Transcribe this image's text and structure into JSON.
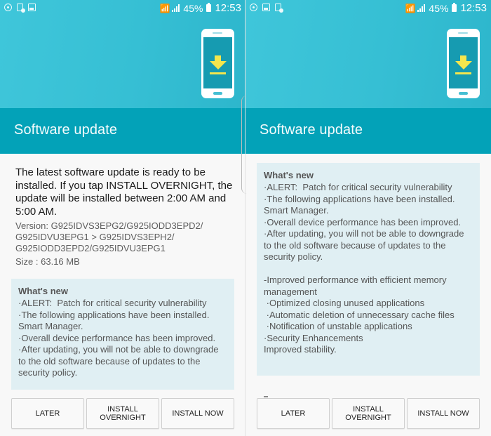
{
  "status_bar": {
    "battery_percent": "45%",
    "time": "12:53",
    "left_icons_screen1": [
      "target-icon",
      "doc-clock-icon",
      "image-icon"
    ],
    "left_icons_screen2": [
      "target-icon",
      "image-icon",
      "doc-clock-icon"
    ],
    "right_icons": [
      "wifi-icon",
      "signal-icon",
      "battery-icon"
    ]
  },
  "header": {
    "title": "Software update",
    "illustration": "phone-download-icon"
  },
  "screen1": {
    "intro": "The latest software update is ready to be installed. If you tap INSTALL OVERNIGHT, the update will be installed between 2:00 AM and 5:00 AM.",
    "version": "Version: G925IDVS3EPG2/G925IODD3EPD2/ G925IDVU3EPG1 > G925IDVS3EPH2/ G925IODD3EPD2/G925IDVU3EPG1",
    "size": "Size : 63.16 MB",
    "whats_new_title": "What's new",
    "whats_new_text": "·ALERT:  Patch for critical security vulnerability\n·The following applications have been installed.\nSmart Manager.\n·Overall device performance has been improved.\n·After updating, you will not be able to downgrade to the old software because of updates to the security policy."
  },
  "screen2": {
    "whats_new_title": "What's new",
    "whats_new_text": "·ALERT:  Patch for critical security vulnerability\n·The following applications have been installed.\nSmart Manager.\n·Overall device performance has been improved.\n·After updating, you will not be able to downgrade to the old software because of updates to the security policy.\n\n-Improved performance with efficient memory management\n ·Optimized closing unused applications\n ·Automatic deletion of unnecessary cache files\n ·Notification of unstable applications\n·Security Enhancements\nImproved stability."
  },
  "buttons": {
    "later": "LATER",
    "install_overnight_line1": "INSTALL",
    "install_overnight_line2": "OVERNIGHT",
    "install_now": "INSTALL NOW"
  },
  "colors": {
    "hero": "#36bfd4",
    "titlebar": "#03a2b8",
    "whats_new_bg": "#e0eff3",
    "download_arrow": "#f4e64d"
  }
}
